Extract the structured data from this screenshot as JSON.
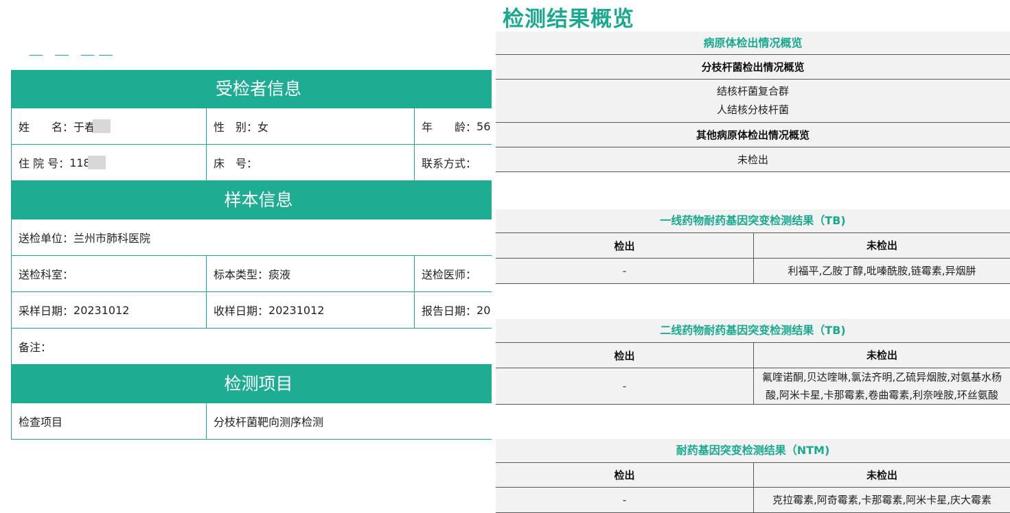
{
  "left": {
    "section1_title": "受检者信息",
    "name_label": "姓　　名：",
    "name_value": "于春",
    "gender_label": "性　别：",
    "gender_value": "女",
    "age_label": "年　　龄：",
    "age_value": "56",
    "hosp_label": "住 院 号：",
    "hosp_value": "118",
    "bed_label": "床　号：",
    "bed_value": "",
    "contact_label": "联系方式：",
    "contact_value": "",
    "section2_title": "样本信息",
    "unit_label": "送检单位：",
    "unit_value": "兰州市肺科医院",
    "dept_label": "送检科室：",
    "dept_value": "",
    "type_label": "标本类型：",
    "type_value": "痰液",
    "doctor_label": "送检医师：",
    "doctor_value": "",
    "sample_date_label": "采样日期：",
    "sample_date_value": "20231012",
    "receive_date_label": "收样日期：",
    "receive_date_value": "20231012",
    "report_date_label": "报告日期：",
    "report_date_value": "20",
    "note_label": "备注：",
    "section3_title": "检测项目",
    "item_label": "检查项目",
    "item_value": "分枝杆菌靶向测序检测"
  },
  "right": {
    "title": "检测结果概览",
    "pathogen_header": "病原体检出情况概览",
    "myco_header": "分枝杆菌检出情况概览",
    "myco_items": [
      "结核杆菌复合群",
      "人结核分枝杆菌"
    ],
    "other_header": "其他病原体检出情况概览",
    "other_value": "未检出",
    "col_detected": "检出",
    "col_not_detected": "未检出",
    "first_line": {
      "title": "一线药物耐药基因突变检测结果（TB)",
      "detected": "-",
      "not_detected": "利福平,乙胺丁醇,吡嗪酰胺,链霉素,异烟肼"
    },
    "second_line": {
      "title": "二线药物耐药基因突变检测结果（TB)",
      "detected": "-",
      "not_detected": "氟喹诺酮,贝达喹啉,氯法齐明,乙硫异烟胺,对氨基水杨酸,阿米卡星,卡那霉素,卷曲霉素,利奈唑胺,环丝氨酸"
    },
    "ntm": {
      "title": "耐药基因突变检测结果（NTM)",
      "detected": "-",
      "not_detected": "克拉霉素,阿奇霉素,卡那霉素,阿米卡星,庆大霉素"
    }
  }
}
